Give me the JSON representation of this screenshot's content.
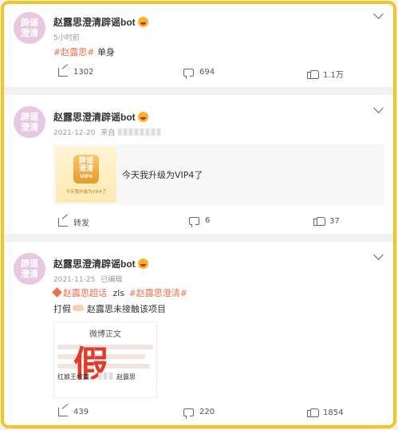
{
  "colors": {
    "accent": "#eb7350",
    "frame": "#f5c623"
  },
  "posts": [
    {
      "avatar": {
        "line1": "辟谣",
        "line2": "澄清"
      },
      "author": "赵露思澄清辟谣bot",
      "time": "5小时前",
      "source_prefix": "",
      "tag": "#赵露思#",
      "text": "单身",
      "actions": {
        "share": "1302",
        "comment": "694",
        "like": "1.1万"
      }
    },
    {
      "avatar": {
        "line1": "辟谣",
        "line2": "澄清"
      },
      "author": "赵露思澄清辟谣bot",
      "time": "2021-12-20",
      "source_prefix": "来自",
      "repost_card": {
        "badge_line1": "辟谣",
        "badge_line2": "澄清",
        "badge_vip": "VIP4",
        "img_text": "今天我升级为VIP4了",
        "caption": "今天我升级为VIP4了"
      },
      "actions": {
        "share": "转发",
        "comment": "6",
        "like": "37"
      }
    },
    {
      "avatar": {
        "line1": "辟谣",
        "line2": "澄清"
      },
      "author": "赵露思澄清辟谣bot",
      "time": "2021-11-25",
      "edited": "已编辑",
      "topic_super": "赵露思超话",
      "mid_text": "zls",
      "topic_tag": "#赵露思澄清#",
      "body_prefix": "打假",
      "body_rest": "赵露思未接触该项目",
      "image": {
        "title": "微博正文",
        "big_char": "假",
        "footer": "红娘王权篇，",
        "footer_name": "赵露思"
      },
      "actions": {
        "share": "439",
        "comment": "220",
        "like": "1854"
      }
    }
  ]
}
